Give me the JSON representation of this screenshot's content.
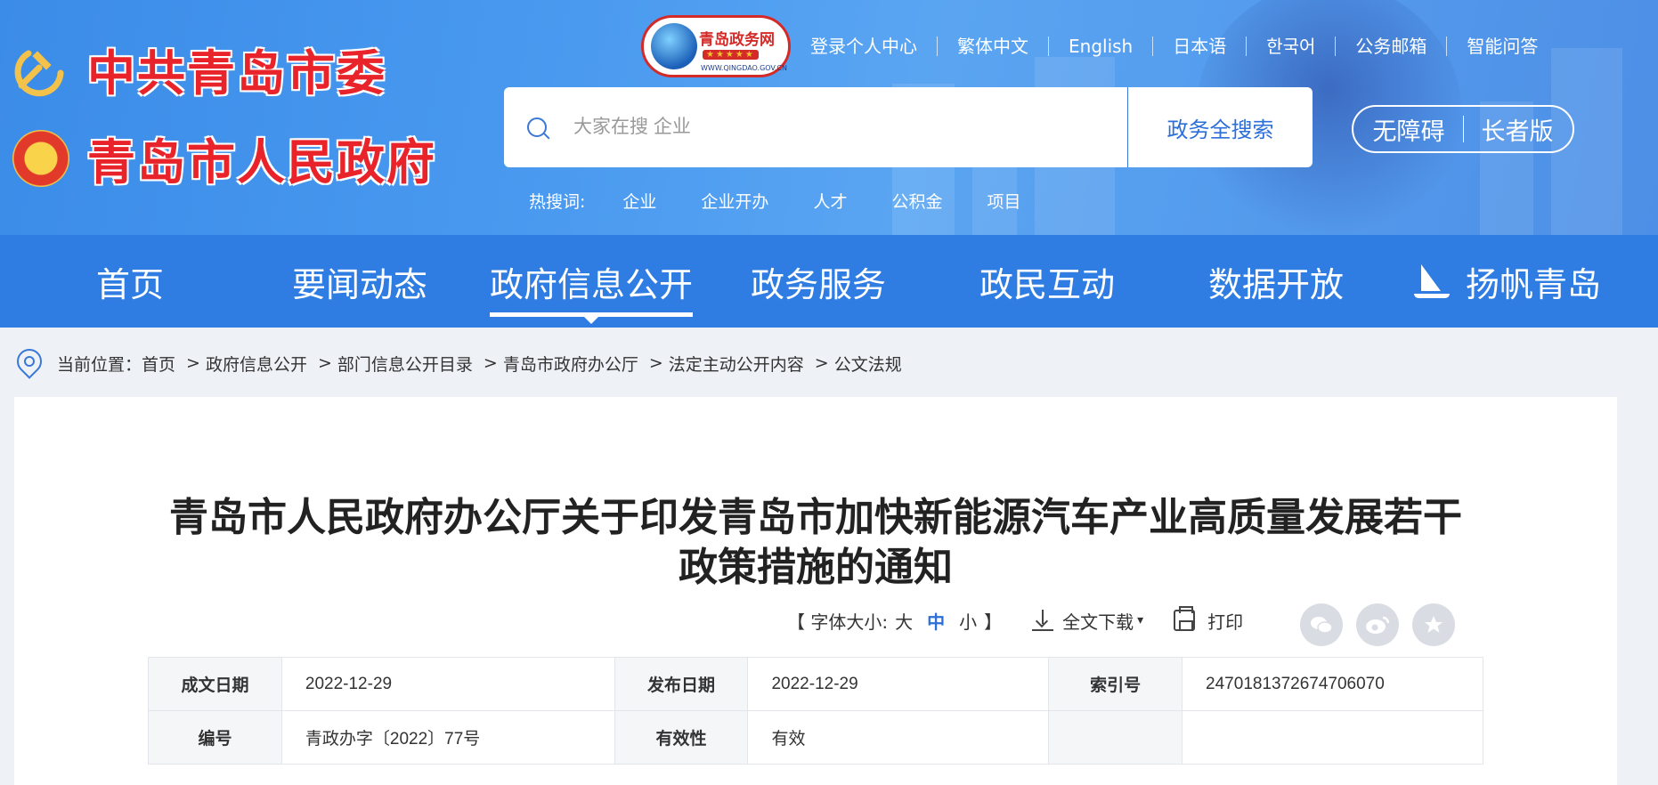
{
  "logos": {
    "party_name": "中共青岛市委",
    "gov_name": "青岛市人民政府"
  },
  "portal_badge": {
    "name": "青岛政务网",
    "stars": "★★★★★",
    "url": "WWW.QINGDAO.GOV.CN"
  },
  "top_links": [
    "登录个人中心",
    "繁体中文",
    "English",
    "日本语",
    "한국어",
    "公务邮箱",
    "智能问答"
  ],
  "search": {
    "placeholder": "大家在搜 企业",
    "button": "政务全搜索"
  },
  "accessibility": {
    "barrier_free": "无障碍",
    "elderly": "长者版"
  },
  "hotwords": {
    "label": "热搜词:",
    "items": [
      "企业",
      "企业开办",
      "人才",
      "公积金",
      "项目"
    ]
  },
  "nav": {
    "items": [
      "首页",
      "要闻动态",
      "政府信息公开",
      "政务服务",
      "政民互动",
      "数据开放",
      "扬帆青岛"
    ],
    "active": "政府信息公开"
  },
  "breadcrumb": {
    "label": "当前位置：",
    "items": [
      "首页",
      "政府信息公开",
      "部门信息公开目录",
      "青岛市政府办公厅",
      "法定主动公开内容",
      "公文法规"
    ],
    "separator": ">"
  },
  "document": {
    "title_line1": "青岛市人民政府办公厅关于印发青岛市加快新能源汽车产业高质量发展若干",
    "title_line2": "政策措施的通知"
  },
  "toolbar": {
    "font_size_label": "【 字体大小: ",
    "font_large": "大",
    "font_medium": "中",
    "font_small": "小",
    "font_size_close": "】",
    "download": "全文下载",
    "download_caret": "▾",
    "print": "打印"
  },
  "share_icons": [
    "wechat-icon",
    "weibo-icon",
    "favorite-icon"
  ],
  "meta": {
    "rows": [
      [
        {
          "k": "成文日期",
          "v": "2022-12-29"
        },
        {
          "k": "发布日期",
          "v": "2022-12-29"
        },
        {
          "k": "索引号",
          "v": "2470181372674706070"
        }
      ],
      [
        {
          "k": "编号",
          "v": "青政办字〔2022〕77号"
        },
        {
          "k": "有效性",
          "v": "有效"
        },
        {
          "k": "",
          "v": ""
        }
      ]
    ]
  },
  "colors": {
    "header_bg": "#4a9af0",
    "nav_bg": "#2f7de3",
    "logo_red": "#e8242a",
    "accent_blue": "#2c6fd8"
  }
}
